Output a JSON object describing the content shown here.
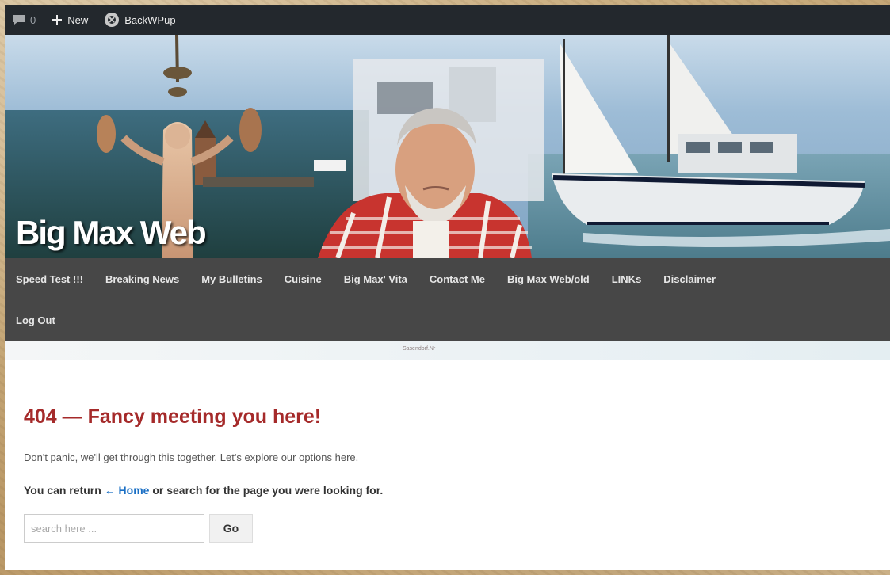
{
  "admin_bar": {
    "comments_count": "0",
    "new_label": "New",
    "plugin_label": "BackWPup",
    "icons": [
      "comment-icon",
      "plus-icon",
      "backwpup-icon"
    ]
  },
  "header": {
    "site_title": "Big Max Web",
    "strip_label": "Sasendorf.Nr"
  },
  "nav": {
    "row1": [
      "Speed Test !!!",
      "Breaking News",
      "My Bulletins",
      "Cuisine",
      "Big Max' Vita",
      "Contact Me",
      "Big Max Web/old",
      "LINKs",
      "Disclaimer"
    ],
    "row2": [
      "Log Out"
    ]
  },
  "content": {
    "title": "404 — Fancy meeting you here!",
    "description": "Don't panic, we'll get through this together. Let's explore our options here.",
    "return_prefix": "You can return",
    "home_link": "← Home",
    "return_suffix": "or search for the page you were looking for.",
    "search_placeholder": "search here ...",
    "go_label": "Go"
  },
  "colors": {
    "admin_bar": "#23282d",
    "nav_bg": "#474747",
    "error_title": "#a52a2a",
    "link": "#1a6fc4"
  }
}
